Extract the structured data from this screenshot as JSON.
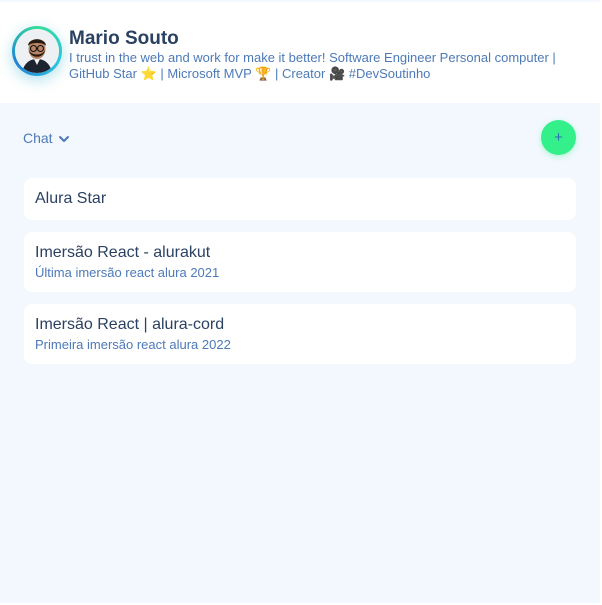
{
  "profile": {
    "name": "Mario Souto",
    "bio": "I trust in the web and work for make it better! Software Engineer Personal computer | GitHub Star ⭐ | Microsoft MVP 🏆 | Creator 🎥 #DevSoutinho"
  },
  "toolbar": {
    "section_label": "Chat",
    "add_label": "+"
  },
  "list": [
    {
      "title": "Alura Star",
      "subtitle": ""
    },
    {
      "title": "Imersão React - alurakut",
      "subtitle": "Última imersão react alura 2021"
    },
    {
      "title": "Imersão React | alura-cord",
      "subtitle": "Primeira imersão react alura 2022"
    }
  ],
  "colors": {
    "background": "#f2f8fe",
    "accent": "#33f08a",
    "title": "#2b4162",
    "text": "#4d7ab8"
  }
}
